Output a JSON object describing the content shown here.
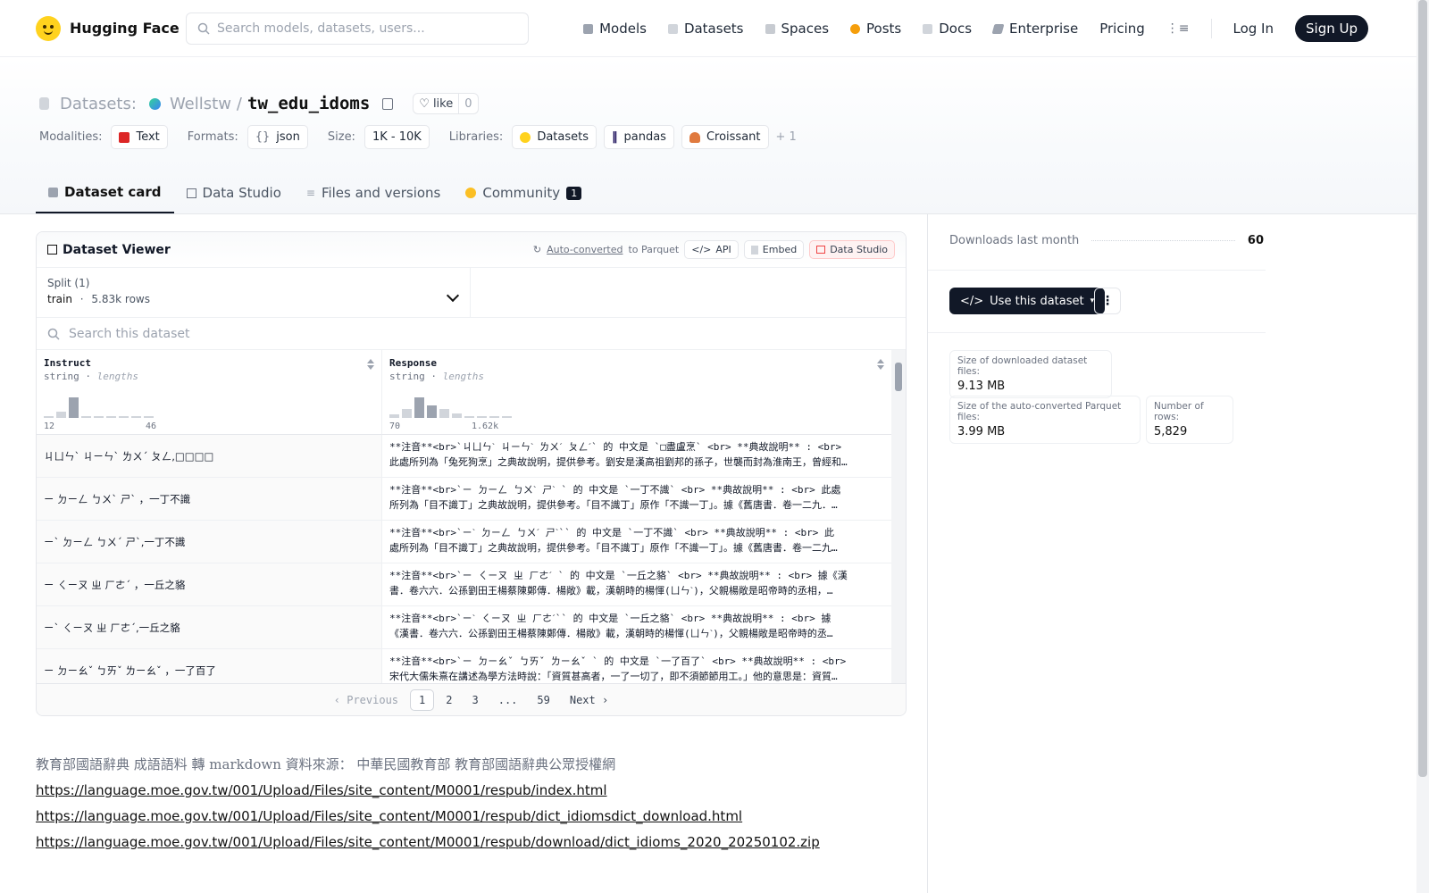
{
  "nav": {
    "brand": "Hugging Face",
    "search_placeholder": "Search models, datasets, users...",
    "links": [
      "Models",
      "Datasets",
      "Spaces",
      "Posts",
      "Docs",
      "Enterprise",
      "Pricing"
    ],
    "login": "Log In",
    "signup": "Sign Up"
  },
  "header": {
    "section": "Datasets:",
    "owner": "Wellstw",
    "slash": "/",
    "name": "tw_edu_idoms",
    "like_label": "like",
    "like_count": "0",
    "tags": {
      "modalities_label": "Modalities:",
      "modalities": "Text",
      "formats_label": "Formats:",
      "formats": "json",
      "size_label": "Size:",
      "size": "1K - 10K",
      "libraries_label": "Libraries:",
      "libraries": [
        "Datasets",
        "pandas",
        "Croissant"
      ],
      "more": "+ 1"
    },
    "tabs": [
      "Dataset card",
      "Data Studio",
      "Files and versions",
      "Community"
    ],
    "community_badge": "1"
  },
  "viewer": {
    "title": "Dataset Viewer",
    "auto_converted": "Auto-converted",
    "to_parquet": "to Parquet",
    "api": "API",
    "embed": "Embed",
    "data_studio": "Data Studio",
    "split_label": "Split (1)",
    "split_name": "train",
    "split_dot": "·",
    "split_rows": "5.83k rows",
    "search_placeholder": "Search this dataset",
    "columns": [
      {
        "name": "Instruct",
        "type": "string",
        "stat": "lengths",
        "min": "12",
        "max": "46",
        "hist": [
          0.05,
          0.25,
          0.9,
          0.05,
          0.05,
          0.05,
          0.05,
          0.05,
          0.05
        ]
      },
      {
        "name": "Response",
        "type": "string",
        "stat": "lengths",
        "min": "70",
        "max": "1.62k",
        "hist": [
          0.15,
          0.4,
          0.9,
          0.55,
          0.4,
          0.2,
          0.05,
          0.05,
          0.05,
          0.05
        ]
      }
    ],
    "rows": [
      {
        "instruct": "ㄐㄩㄣˋ ㄐㄧㄣˋ ㄌㄨˊ ㄆㄥ,□□□□",
        "r1": "**注音**<br>`ㄐㄩㄣˋ ㄐㄧㄣˋ ㄌㄨˊ ㄆㄥˊ` 的 中文是 `□盡盧烹` <br> **典故說明** : <br>",
        "r2": "此處所列為「兔死狗烹」之典故說明，提供參考。劉安是漢高祖劉邦的孫子，世襲而封為淮南王，曾經和…"
      },
      {
        "instruct": "ㄧ ㄉㄧㄥ ㄅㄨˋ ㄕˋ ，一丁不識",
        "r1": "**注音**<br>`ㄧ ㄉㄧㄥ ㄅㄨˋ ㄕˋ ` 的 中文是 `一丁不識` <br> **典故說明** : <br> 此處",
        "r2": "所列為「目不識丁」之典故說明，提供參考。「目不識丁」原作「不識一丁」。據《舊唐書．卷一二九．…"
      },
      {
        "instruct": "ㄧˋ ㄉㄧㄥ ㄅㄨˊ ㄕˋ,一丁不識",
        "r1": "**注音**<br>`ㄧˋ ㄉㄧㄥ ㄅㄨˊ ㄕˋ`` 的 中文是 `一丁不識` <br> **典故說明** : <br> 此",
        "r2": "處所列為「目不識丁」之典故說明，提供參考。「目不識丁」原作「不識一丁」。據《舊唐書．卷一二九…"
      },
      {
        "instruct": "ㄧ ㄑㄧㄡ ㄓ ㄏㄜˊ ，一丘之貉",
        "r1": "**注音**<br>`ㄧ ㄑㄧㄡ ㄓ ㄏㄜˊ ` 的 中文是 `一丘之貉` <br> **典故說明** : <br> 據《漢",
        "r2": "書．卷六六．公孫劉田王楊蔡陳鄭傳．楊敞》載，漢朝時的楊惲(ㄩㄣˋ)，父親楊敞是昭帝時的丞相，…"
      },
      {
        "instruct": "ㄧˋ ㄑㄧㄡ ㄓ ㄏㄜˊ,一丘之貉",
        "r1": "**注音**<br>`ㄧˋ ㄑㄧㄡ ㄓ ㄏㄜˊ`` 的 中文是 `一丘之貉` <br> **典故說明** : <br> 據",
        "r2": "《漢書．卷六六．公孫劉田王楊蔡陳鄭傳．楊敞》載，漢朝時的楊惲(ㄩㄣˋ)，父親楊敞是昭帝時的丞…"
      },
      {
        "instruct": "ㄧ ㄉㄧㄠˇ ㄅㄞˇ ㄌㄧㄠˇ ，一了百了",
        "r1": "**注音**<br>`ㄧ ㄉㄧㄠˇ ㄅㄞˇ ㄌㄧㄠˇ ` 的 中文是 `一了百了` <br> **典故說明** : <br>",
        "r2": "宋代大儒朱熹在講述為學方法時說：「資質甚高者，一了一切了，即不須節節用工。」他的意思是：資質…"
      }
    ],
    "pager": {
      "prev": "Previous",
      "pages": [
        "1",
        "2",
        "3",
        "...",
        "59"
      ],
      "next": "Next"
    }
  },
  "readme": {
    "intro": "教育部國語辭典 成語語料 轉 markdown 資料來源：  中華民國教育部 教育部國語辭典公眾授權網",
    "links": [
      "https://language.moe.gov.tw/001/Upload/Files/site_content/M0001/respub/index.html",
      "https://language.moe.gov.tw/001/Upload/Files/site_content/M0001/respub/dict_idiomsdict_download.html",
      "https://language.moe.gov.tw/001/Upload/Files/site_content/M0001/respub/download/dict_idioms_2020_20250102.zip"
    ]
  },
  "sidebar": {
    "downloads_label": "Downloads last month",
    "downloads_value": "60",
    "use_dataset": "Use this dataset",
    "stats": [
      {
        "label": "Size of downloaded dataset files:",
        "value": "9.13 MB"
      },
      {
        "label": "Size of the auto-converted Parquet files:",
        "value": "3.99 MB"
      },
      {
        "label": "Number of rows:",
        "value": "5,829"
      }
    ]
  },
  "colors": {
    "accent_dark": "#111827",
    "hf_yellow": "#ffd21e",
    "data_studio_red": "#ef4444"
  }
}
